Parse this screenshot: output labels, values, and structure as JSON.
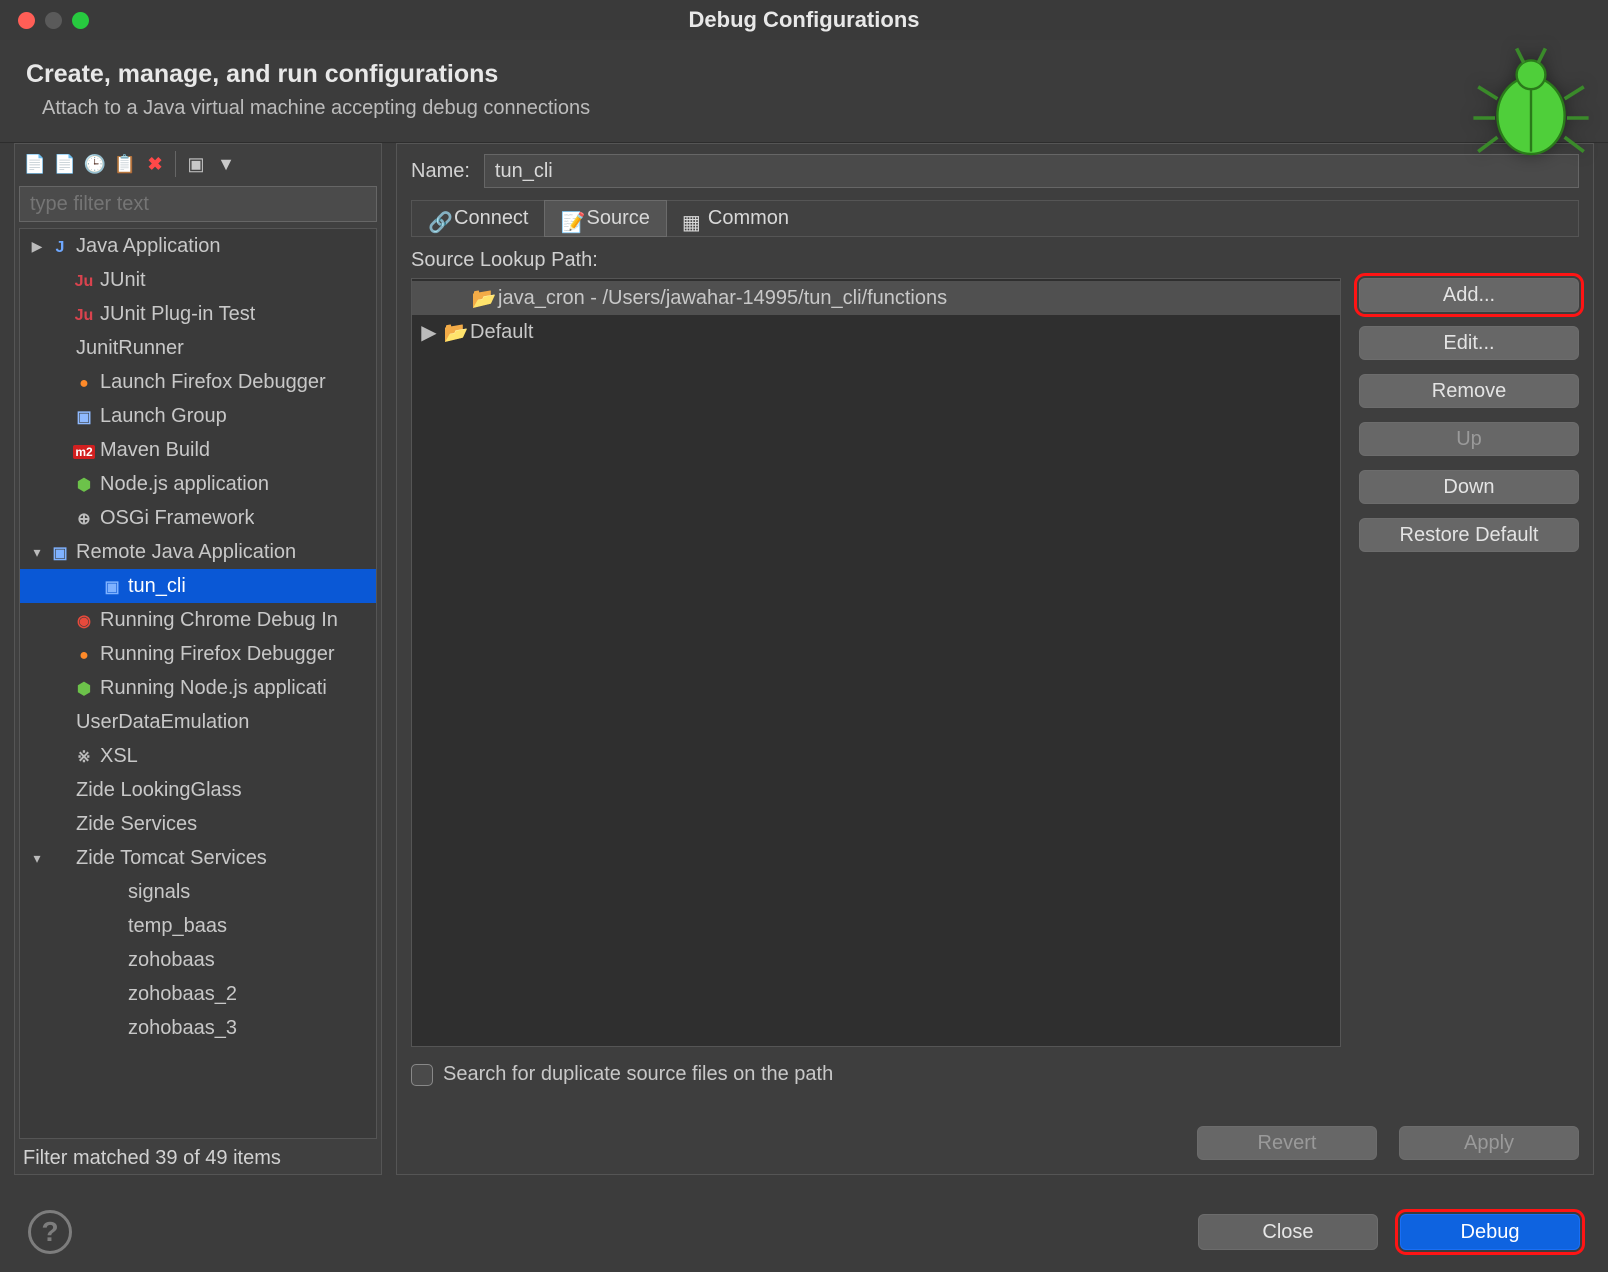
{
  "window": {
    "title": "Debug Configurations"
  },
  "header": {
    "title": "Create, manage, and run configurations",
    "subtitle": "Attach to a Java virtual machine accepting debug connections"
  },
  "left": {
    "filter_placeholder": "type filter text",
    "status": "Filter matched 39 of 49 items",
    "tree": [
      {
        "label": "Java Application",
        "icon": "java",
        "exp": "▶",
        "depth": 0
      },
      {
        "label": "JUnit",
        "icon": "junit",
        "depth": 1
      },
      {
        "label": "JUnit Plug-in Test",
        "icon": "junit",
        "depth": 1
      },
      {
        "label": "JunitRunner",
        "icon": "",
        "depth": 0
      },
      {
        "label": "Launch Firefox Debugger",
        "icon": "ff",
        "depth": 1
      },
      {
        "label": "Launch Group",
        "icon": "grp",
        "depth": 1
      },
      {
        "label": "Maven Build",
        "icon": "mvn",
        "depth": 1
      },
      {
        "label": "Node.js application",
        "icon": "node",
        "depth": 1
      },
      {
        "label": "OSGi Framework",
        "icon": "osgi",
        "depth": 1
      },
      {
        "label": "Remote Java Application",
        "icon": "remote",
        "exp": "▾",
        "depth": 0
      },
      {
        "label": "tun_cli",
        "icon": "remote",
        "depth": 2,
        "selected": true
      },
      {
        "label": "Running Chrome Debug In",
        "icon": "chrome",
        "depth": 1
      },
      {
        "label": "Running Firefox Debugger",
        "icon": "ff",
        "depth": 1
      },
      {
        "label": "Running Node.js applicati",
        "icon": "node",
        "depth": 1
      },
      {
        "label": "UserDataEmulation",
        "icon": "",
        "depth": 0
      },
      {
        "label": "XSL",
        "icon": "xsl",
        "depth": 1
      },
      {
        "label": "Zide LookingGlass",
        "icon": "",
        "depth": 0
      },
      {
        "label": "Zide Services",
        "icon": "",
        "depth": 0
      },
      {
        "label": "Zide Tomcat Services",
        "icon": "",
        "exp": "▾",
        "depth": 0
      },
      {
        "label": "signals",
        "icon": "",
        "depth": 2
      },
      {
        "label": "temp_baas",
        "icon": "",
        "depth": 2
      },
      {
        "label": "zohobaas",
        "icon": "",
        "depth": 2
      },
      {
        "label": "zohobaas_2",
        "icon": "",
        "depth": 2
      },
      {
        "label": "zohobaas_3",
        "icon": "",
        "depth": 2
      }
    ]
  },
  "right": {
    "name_label": "Name:",
    "name_value": "tun_cli",
    "tabs": [
      {
        "label": "Connect",
        "active": false
      },
      {
        "label": "Source",
        "active": true
      },
      {
        "label": "Common",
        "active": false
      }
    ],
    "source_label": "Source Lookup Path:",
    "source_items": [
      {
        "label": "java_cron - /Users/jawahar-14995/tun_cli/functions",
        "exp": "",
        "selected": true,
        "indent": 1
      },
      {
        "label": "Default",
        "exp": "▶",
        "indent": 0
      }
    ],
    "buttons": {
      "add": "Add...",
      "edit": "Edit...",
      "remove": "Remove",
      "up": "Up",
      "down": "Down",
      "restore": "Restore Default"
    },
    "dup_label": "Search for duplicate source files on the path",
    "revert": "Revert",
    "apply": "Apply"
  },
  "footer": {
    "close": "Close",
    "debug": "Debug"
  }
}
